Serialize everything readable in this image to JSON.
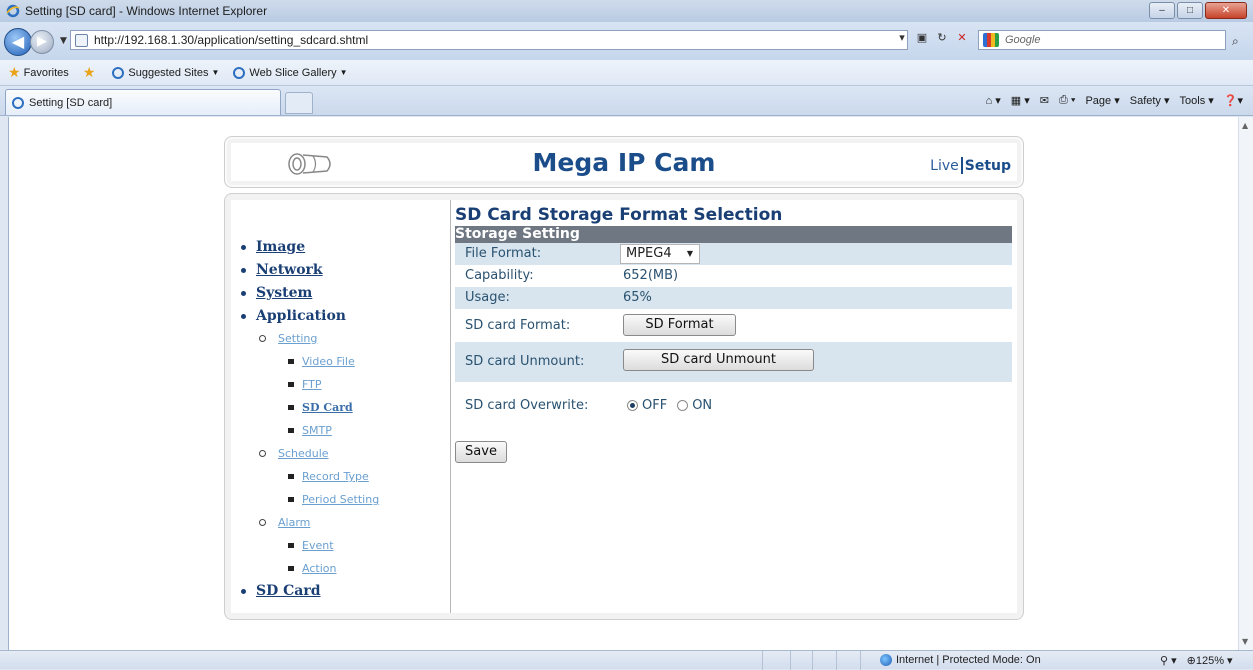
{
  "browser": {
    "window_title": "Setting [SD card] - Windows Internet Explorer",
    "url": "http://192.168.1.30/application/setting_sdcard.shtml",
    "search_placeholder": "Google",
    "favorites_label": "Favorites",
    "fav_items": [
      "Suggested Sites",
      "Web Slice Gallery"
    ],
    "tab_title": "Setting [SD card]",
    "cmd_items": [
      "Page",
      "Safety",
      "Tools"
    ],
    "status_zone": "Internet | Protected Mode: On",
    "zoom": "125%"
  },
  "header": {
    "brand": "Mega IP Cam",
    "live_link": "Live",
    "setup_link": "Setup"
  },
  "sidebar": {
    "image": "Image",
    "network": "Network",
    "system": "System",
    "application": "Application",
    "setting": "Setting",
    "video_file": "Video File",
    "ftp": "FTP",
    "sd_card_sub": "SD Card",
    "smtp": "SMTP",
    "schedule": "Schedule",
    "record_type": "Record Type",
    "period_setting": "Period Setting",
    "alarm": "Alarm",
    "event": "Event",
    "action": "Action",
    "sd_card": "SD Card"
  },
  "content": {
    "title": "SD Card Storage Format Selection",
    "section": "Storage Setting",
    "file_format_label": "File Format:",
    "file_format_value": "MPEG4",
    "capability_label": "Capability:",
    "capability_value": "652(MB)",
    "usage_label": "Usage:",
    "usage_value": "65%",
    "format_label": "SD card Format:",
    "format_button": "SD Format",
    "unmount_label": "SD card Unmount:",
    "unmount_button": "SD card Unmount",
    "overwrite_label": "SD card Overwrite:",
    "overwrite_off": "OFF",
    "overwrite_on": "ON",
    "overwrite_selected": "OFF",
    "save_button": "Save"
  }
}
